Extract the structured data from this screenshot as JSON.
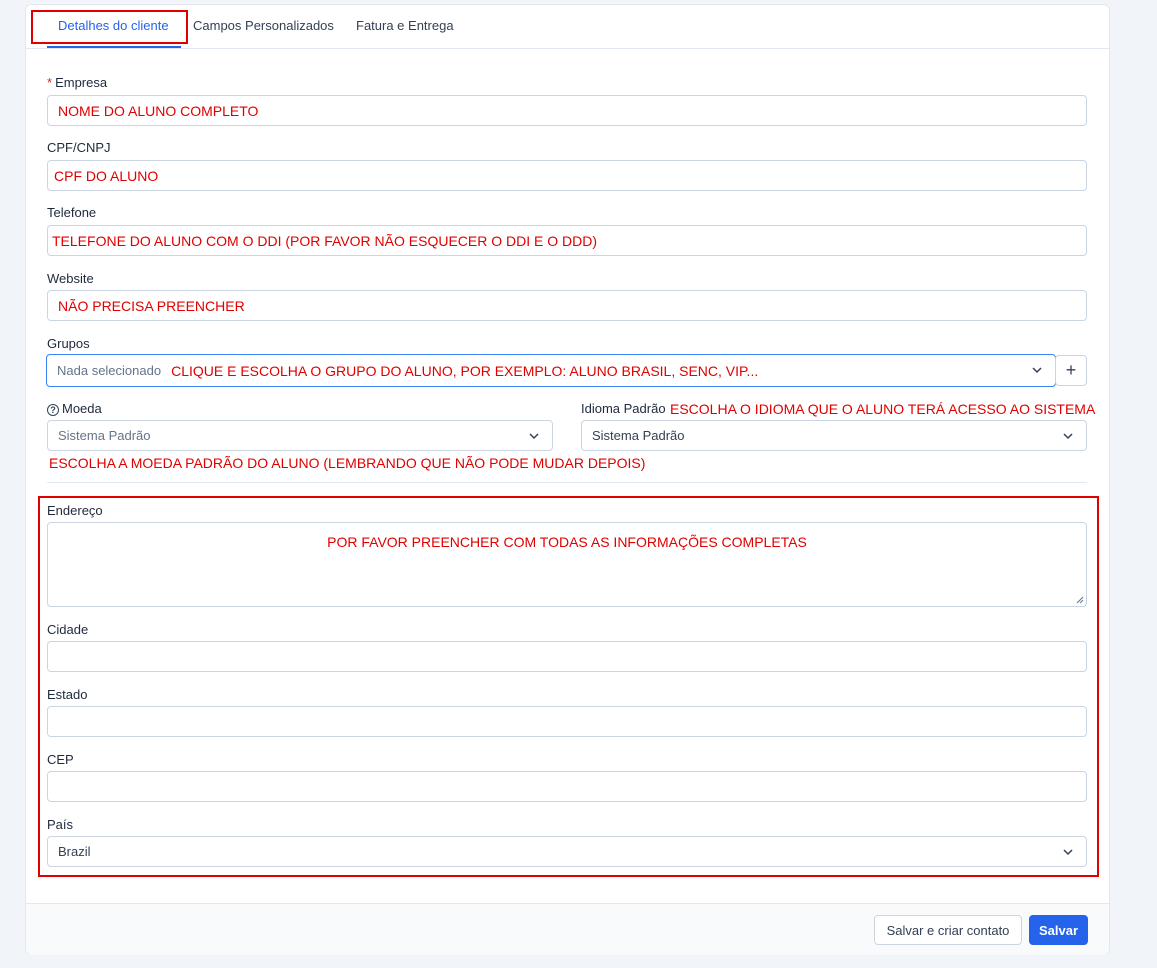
{
  "tabs": [
    {
      "label": "Detalhes do cliente",
      "active": true
    },
    {
      "label": "Campos Personalizados",
      "active": false
    },
    {
      "label": "Fatura e Entrega",
      "active": false
    }
  ],
  "form": {
    "empresa": {
      "required_mark": "*",
      "label": "Empresa",
      "value": "NOME DO ALUNO COMPLETO"
    },
    "cpf": {
      "label": "CPF/CNPJ",
      "value": "CPF DO ALUNO"
    },
    "telefone": {
      "label": "Telefone",
      "value": "TELEFONE DO ALUNO COM O DDI (POR FAVOR NÃO ESQUECER O DDI E O DDD)"
    },
    "website": {
      "label": "Website",
      "value": "NÃO PRECISA PREENCHER"
    },
    "grupos": {
      "label": "Grupos",
      "placeholder": "Nada selecionado",
      "note": "CLIQUE E ESCOLHA O GRUPO DO ALUNO, POR EXEMPLO: ALUNO BRASIL, SENC, VIP..."
    },
    "moeda": {
      "label": "Moeda",
      "help_icon": "question-circle-icon",
      "placeholder": "Sistema Padrão",
      "note": "ESCOLHA A MOEDA PADRÃO DO ALUNO (LEMBRANDO QUE NÃO PODE MUDAR DEPOIS)"
    },
    "idioma": {
      "label": "Idioma Padrão",
      "note": "ESCOLHA O IDIOMA QUE O ALUNO TERÁ ACESSO AO SISTEMA",
      "value": "Sistema Padrão"
    },
    "endereco": {
      "label": "Endereço",
      "value": "POR FAVOR PREENCHER COM TODAS AS INFORMAÇÕES COMPLETAS"
    },
    "cidade": {
      "label": "Cidade",
      "value": ""
    },
    "estado": {
      "label": "Estado",
      "value": ""
    },
    "cep": {
      "label": "CEP",
      "value": ""
    },
    "pais": {
      "label": "País",
      "value": "Brazil"
    }
  },
  "footer": {
    "save_and_create_label": "Salvar e criar contato",
    "save_label": "Salvar"
  },
  "colors": {
    "accent": "#2563eb",
    "annotation": "#e00000"
  }
}
